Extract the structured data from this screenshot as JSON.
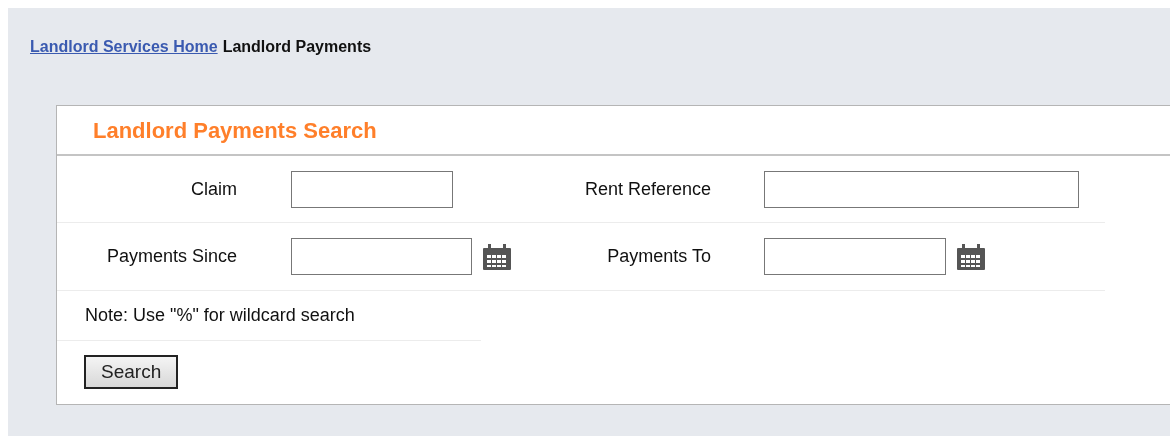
{
  "breadcrumb": [
    {
      "label": "Landlord Services Home",
      "kind": "link"
    },
    {
      "label": "Landlord Payments",
      "kind": "current"
    }
  ],
  "panel": {
    "title": "Landlord Payments Search",
    "rows": [
      [
        {
          "label": "Claim",
          "kind": "text"
        },
        {
          "label": "Rent Reference",
          "kind": "text"
        }
      ],
      [
        {
          "label": "Payments Since",
          "kind": "date"
        },
        {
          "label": "Payments To",
          "kind": "date"
        }
      ]
    ],
    "note": "Note: Use \"%\" for wildcard search",
    "button": "Search"
  }
}
